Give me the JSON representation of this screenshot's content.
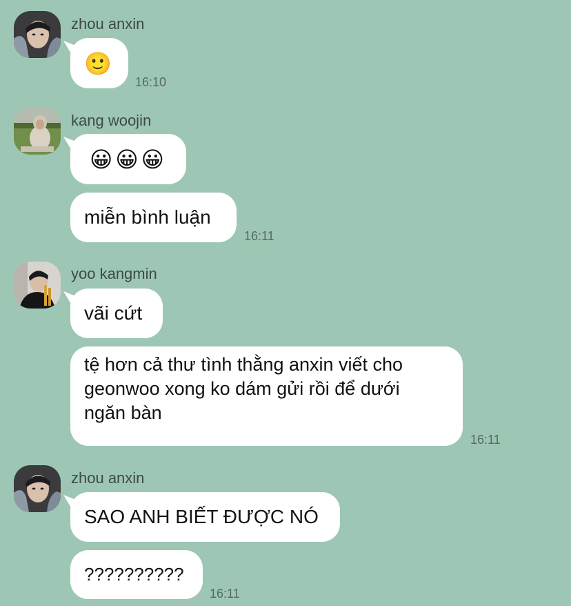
{
  "messages": [
    {
      "sender": "zhou anxin",
      "bubbles": [
        "🙂"
      ],
      "time": "16:10"
    },
    {
      "sender": "kang woojin",
      "bubbles": [
        "😀😀😀",
        "miễn bình luận"
      ],
      "time": "16:11"
    },
    {
      "sender": "yoo kangmin",
      "bubbles": [
        "vãi cứt",
        "tệ hơn cả thư tình thằng anxin viết cho\ngeonwoo xong ko dám gửi rồi để dưới\nngăn bàn"
      ],
      "time": "16:11"
    },
    {
      "sender": "zhou anxin",
      "bubbles": [
        "SAO ANH BIẾT ĐƯỢC NÓ",
        "??????????"
      ],
      "time": "16:11"
    }
  ],
  "colors": {
    "background": "#9dc7b4",
    "bubble": "#ffffff"
  }
}
